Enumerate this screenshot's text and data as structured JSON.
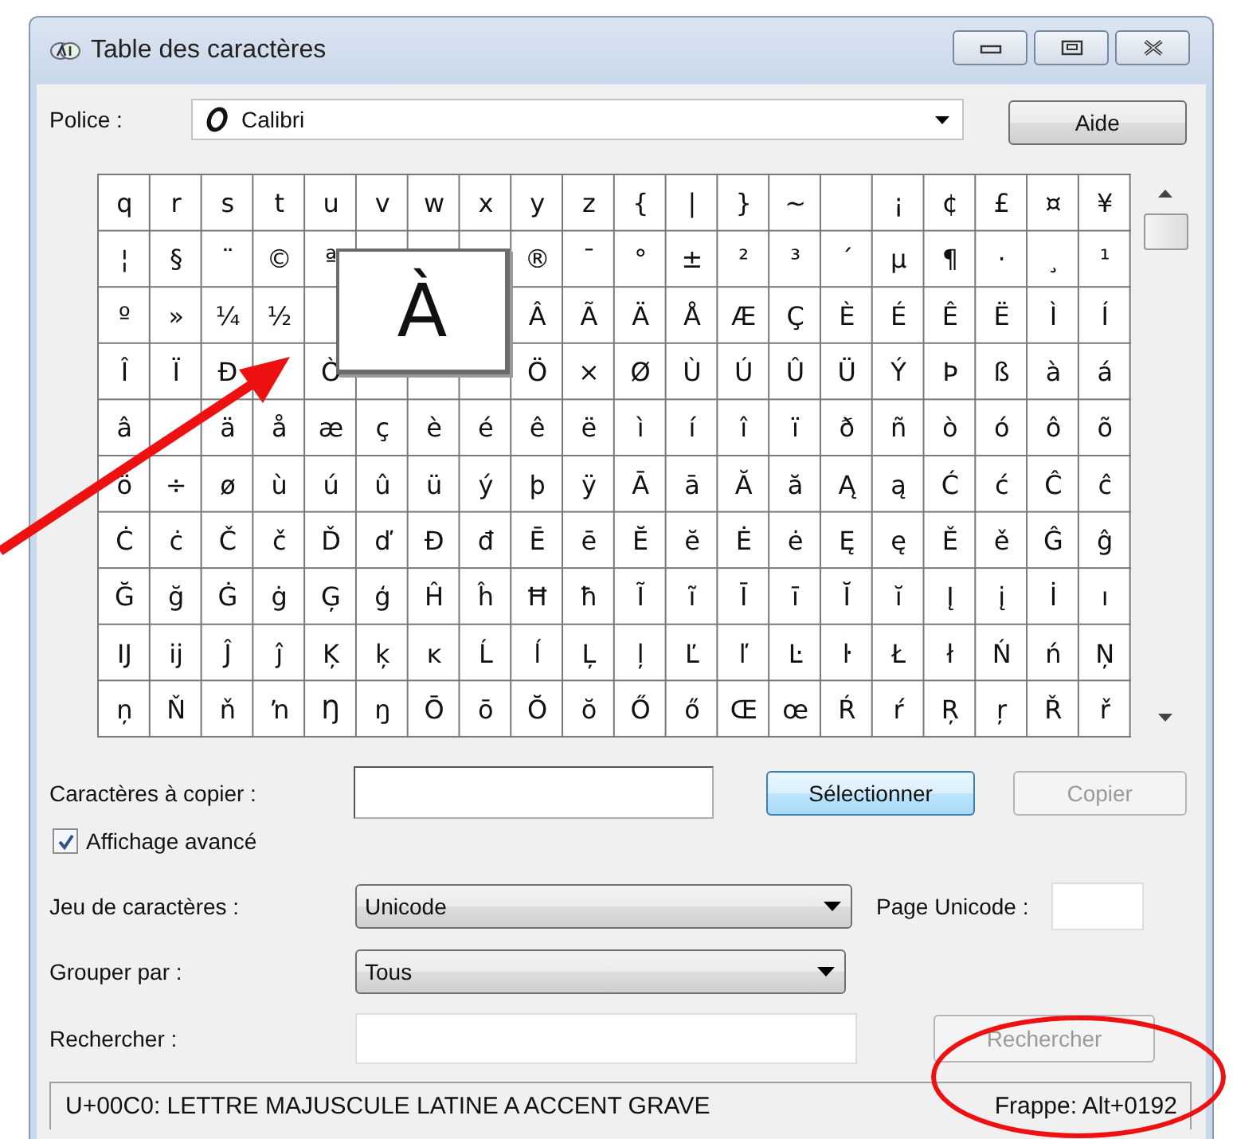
{
  "window": {
    "title": "Table des caractères"
  },
  "font": {
    "label": "Police :",
    "value": "Calibri"
  },
  "help_button": "Aide",
  "grid": {
    "rows": [
      [
        "q",
        "r",
        "s",
        "t",
        "u",
        "v",
        "w",
        "x",
        "y",
        "z",
        "{",
        "|",
        "}",
        "~",
        null,
        "¡",
        "¢",
        "£",
        "¤",
        "¥"
      ],
      [
        "¦",
        "§",
        "¨",
        "©",
        "ª",
        null,
        null,
        null,
        "®",
        "¯",
        "°",
        "±",
        "²",
        "³",
        "´",
        "µ",
        "¶",
        "·",
        "¸",
        "¹"
      ],
      [
        "º",
        "»",
        "¼",
        "½",
        null,
        null,
        null,
        null,
        "Â",
        "Ã",
        "Ä",
        "Å",
        "Æ",
        "Ç",
        "È",
        "É",
        "Ê",
        "Ë",
        "Ì",
        "Í"
      ],
      [
        "Î",
        "Ï",
        "Ð",
        null,
        "Ò",
        null,
        null,
        null,
        "Ö",
        "×",
        "Ø",
        "Ù",
        "Ú",
        "Û",
        "Ü",
        "Ý",
        "Þ",
        "ß",
        "à",
        "á"
      ],
      [
        "â",
        null,
        "ä",
        "å",
        "æ",
        "ç",
        "è",
        "é",
        "ê",
        "ë",
        "ì",
        "í",
        "î",
        "ï",
        "ð",
        "ñ",
        "ò",
        "ó",
        "ô",
        "õ"
      ],
      [
        "ö",
        "÷",
        "ø",
        "ù",
        "ú",
        "û",
        "ü",
        "ý",
        "þ",
        "ÿ",
        "Ā",
        "ā",
        "Ă",
        "ă",
        "Ą",
        "ą",
        "Ć",
        "ć",
        "Ĉ",
        "ĉ"
      ],
      [
        "Ċ",
        "ċ",
        "Č",
        "č",
        "Ď",
        "ď",
        "Đ",
        "đ",
        "Ē",
        "ē",
        "Ĕ",
        "ĕ",
        "Ė",
        "ė",
        "Ę",
        "ę",
        "Ě",
        "ě",
        "Ĝ",
        "ĝ"
      ],
      [
        "Ğ",
        "ğ",
        "Ġ",
        "ġ",
        "Ģ",
        "ģ",
        "Ĥ",
        "ĥ",
        "Ħ",
        "ħ",
        "Ĩ",
        "ĩ",
        "Ī",
        "ī",
        "Ĭ",
        "ĭ",
        "Į",
        "į",
        "İ",
        "ı"
      ],
      [
        "Ĳ",
        "ĳ",
        "Ĵ",
        "ĵ",
        "Ķ",
        "ķ",
        "ĸ",
        "Ĺ",
        "ĺ",
        "Ļ",
        "ļ",
        "Ľ",
        "ľ",
        "Ŀ",
        "ŀ",
        "Ł",
        "ł",
        "Ń",
        "ń",
        "Ņ"
      ],
      [
        "ņ",
        "Ň",
        "ň",
        "ŉ",
        "Ŋ",
        "ŋ",
        "Ō",
        "ō",
        "Ŏ",
        "ŏ",
        "Ő",
        "ő",
        "Œ",
        "œ",
        "Ŕ",
        "ŕ",
        "Ŗ",
        "ŗ",
        "Ř",
        "ř"
      ]
    ],
    "preview": "À"
  },
  "copy": {
    "label": "Caractères à copier :"
  },
  "select_button": "Sélectionner",
  "copy_button": {
    "label": "Copier",
    "disabled": true
  },
  "advanced_view": {
    "label": "Affichage avancé",
    "checked": true
  },
  "charset": {
    "label": "Jeu de caractères :",
    "value": "Unicode"
  },
  "unicode_page": {
    "label": "Page Unicode :"
  },
  "group_by": {
    "label": "Grouper par :",
    "value": "Tous"
  },
  "search": {
    "label": "Rechercher :",
    "button": "Rechercher",
    "button_disabled": true
  },
  "status_bar": {
    "description": "U+00C0: LETTRE MAJUSCULE LATINE A ACCENT GRAVE",
    "keystroke": "Frappe: Alt+0192"
  }
}
